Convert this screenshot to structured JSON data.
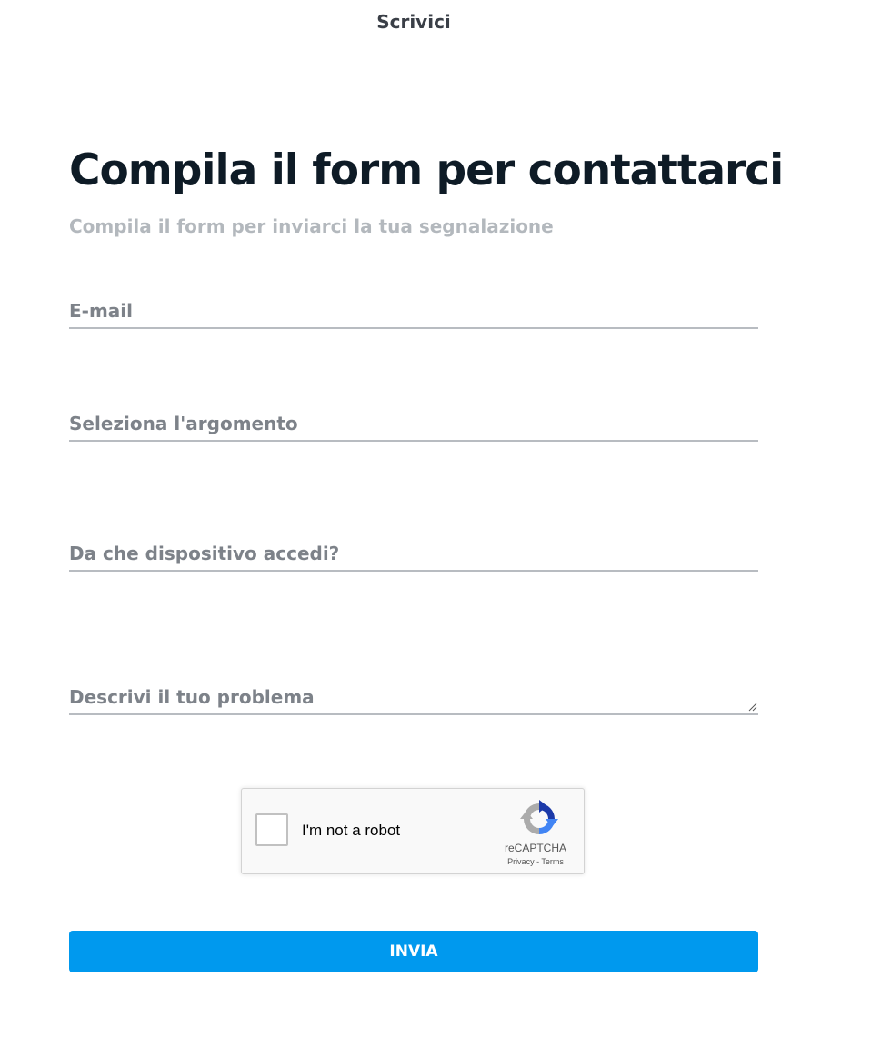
{
  "header": {
    "title": "Scrivici"
  },
  "form": {
    "heading": "Compila il form per contattarci",
    "subheading": "Compila il form per inviarci la tua segnalazione",
    "fields": [
      {
        "label": "E-mail",
        "value": ""
      },
      {
        "label": "Seleziona l'argomento",
        "value": ""
      },
      {
        "label": "Da che dispositivo accedi?",
        "value": ""
      },
      {
        "label": "Descrivi il tuo problema",
        "value": ""
      }
    ],
    "submit_label": "INVIA"
  },
  "captcha": {
    "checkbox_label": "I'm not a robot",
    "brand": "reCAPTCHA",
    "privacy_label": "Privacy",
    "separator": " - ",
    "terms_label": "Terms",
    "checked": false,
    "icon": "recaptcha-logo-icon"
  },
  "colors": {
    "accent": "#0099ee",
    "heading": "#0e1b26",
    "subheading": "#b3b8bd",
    "field_label": "#7d8289",
    "field_border": "#b8bcc1"
  }
}
